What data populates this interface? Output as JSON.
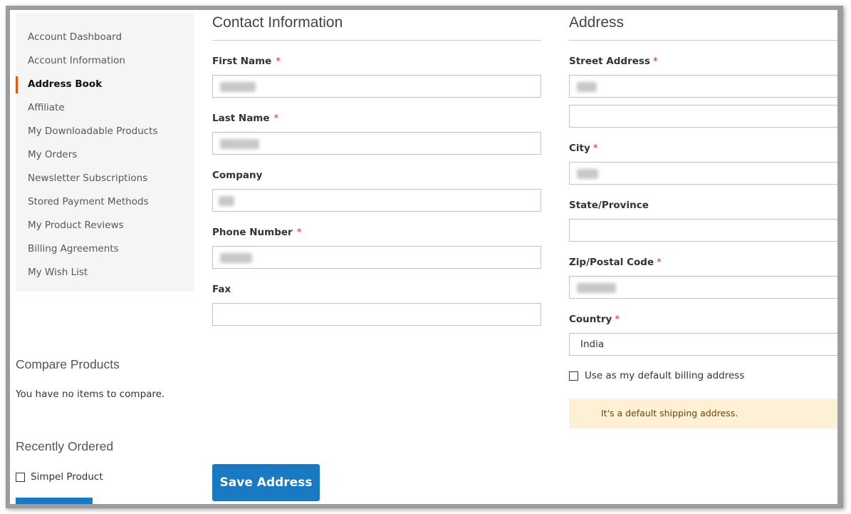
{
  "sidebar": {
    "items": [
      {
        "label": "Account Dashboard",
        "active": false
      },
      {
        "label": "Account Information",
        "active": false
      },
      {
        "label": "Address Book",
        "active": true
      },
      {
        "label": "Affiliate",
        "active": false
      },
      {
        "label": "My Downloadable Products",
        "active": false
      },
      {
        "label": "My Orders",
        "active": false
      },
      {
        "label": "Newsletter Subscriptions",
        "active": false
      },
      {
        "label": "Stored Payment Methods",
        "active": false
      },
      {
        "label": "My Product Reviews",
        "active": false
      },
      {
        "label": "Billing Agreements",
        "active": false
      },
      {
        "label": "My Wish List",
        "active": false
      }
    ],
    "compare": {
      "title": "Compare Products",
      "empty_text": "You have no items to compare."
    },
    "recently_ordered": {
      "title": "Recently Ordered",
      "items": [
        {
          "label": "Simpel Product",
          "checked": false
        }
      ]
    }
  },
  "contact": {
    "title": "Contact Information",
    "fields": {
      "first_name": {
        "label": "First Name",
        "required": "*",
        "value_redacted": true
      },
      "last_name": {
        "label": "Last Name",
        "required": "*",
        "value_redacted": true
      },
      "company": {
        "label": "Company",
        "value_redacted": true
      },
      "phone": {
        "label": "Phone Number",
        "required": "*",
        "value_redacted": true
      },
      "fax": {
        "label": "Fax",
        "value": ""
      }
    }
  },
  "address": {
    "title": "Address",
    "fields": {
      "street": {
        "label": "Street Address",
        "required": "*",
        "value_redacted": true,
        "line2": ""
      },
      "city": {
        "label": "City",
        "required": "*",
        "value_redacted": true
      },
      "state": {
        "label": "State/Province",
        "value": ""
      },
      "zip": {
        "label": "Zip/Postal Code",
        "required": "*",
        "value_redacted": true
      },
      "country": {
        "label": "Country",
        "required": "*",
        "value": "India"
      }
    },
    "default_billing": {
      "label": "Use as my default billing address",
      "checked": false
    },
    "notice": "It's a default shipping address."
  },
  "actions": {
    "save_label": "Save Address"
  },
  "colors": {
    "accent": "#e05b11",
    "primary_button": "#1979c3",
    "required": "#e02b27",
    "notice_bg": "#fdf0d5"
  }
}
